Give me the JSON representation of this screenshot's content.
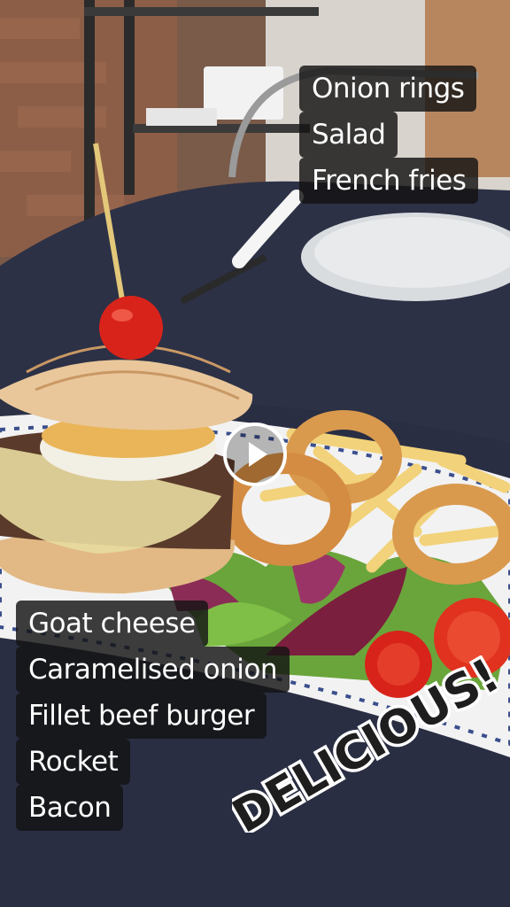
{
  "top_caption": {
    "lines": [
      "Onion rings",
      "Salad",
      "French fries"
    ]
  },
  "bottom_caption": {
    "lines": [
      "Goat cheese",
      "Caramelised onion",
      "Fillet beef burger",
      "Rocket",
      "Bacon"
    ]
  },
  "sticker": {
    "text": "DELICIOUS!"
  },
  "video": {
    "play_icon": "play-icon"
  },
  "colors": {
    "tablecloth": "#2c3146",
    "bun": "#e9c79a",
    "tomato": "#d8231b",
    "onion_ring": "#d99a4e",
    "caption_bg": "#141414"
  }
}
